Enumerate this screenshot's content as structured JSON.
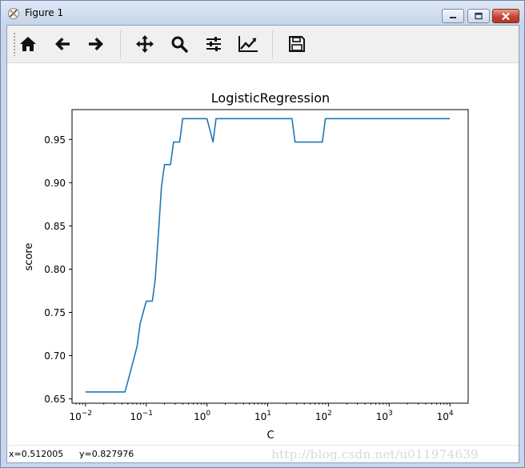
{
  "window": {
    "title": "Figure 1",
    "colors": {
      "accent": "#1f77b4",
      "close": "#c4402b"
    }
  },
  "toolbar": {
    "items": [
      {
        "name": "home-icon",
        "tooltip": "Home"
      },
      {
        "name": "back-arrow-icon",
        "tooltip": "Back"
      },
      {
        "name": "forward-arrow-icon",
        "tooltip": "Forward"
      },
      {
        "name": "pan-icon",
        "tooltip": "Pan"
      },
      {
        "name": "zoom-icon",
        "tooltip": "Zoom"
      },
      {
        "name": "subplots-icon",
        "tooltip": "Subplots"
      },
      {
        "name": "edit-axis-icon",
        "tooltip": "Customize"
      },
      {
        "name": "save-icon",
        "tooltip": "Save"
      }
    ]
  },
  "status": {
    "x_readout": "x=0.512005",
    "y_readout": "y=0.827976",
    "watermark": "http://blog.csdn.net/u011974639"
  },
  "chart_data": {
    "type": "line",
    "title": "LogisticRegression",
    "xlabel": "C",
    "ylabel": "score",
    "xscale": "log",
    "xlim": [
      0.006,
      20000
    ],
    "ylim": [
      0.645,
      0.9845
    ],
    "xticks": [
      {
        "value": 0.01,
        "base": "10",
        "exp": "−2"
      },
      {
        "value": 0.1,
        "base": "10",
        "exp": "−1"
      },
      {
        "value": 1,
        "base": "10",
        "exp": "0"
      },
      {
        "value": 10,
        "base": "10",
        "exp": "1"
      },
      {
        "value": 100,
        "base": "10",
        "exp": "2"
      },
      {
        "value": 1000,
        "base": "10",
        "exp": "3"
      },
      {
        "value": 10000,
        "base": "10",
        "exp": "4"
      }
    ],
    "yticks": [
      "0.65",
      "0.70",
      "0.75",
      "0.80",
      "0.85",
      "0.90",
      "0.95"
    ],
    "grid": false,
    "series": [
      {
        "color": "#1f77b4",
        "x": [
          0.01,
          0.0447,
          0.0562,
          0.0708,
          0.0794,
          0.1,
          0.126,
          0.141,
          0.159,
          0.178,
          0.2,
          0.251,
          0.282,
          0.355,
          0.398,
          1.0,
          1.26,
          1.41,
          10,
          25.1,
          28.2,
          79.4,
          89.1,
          100,
          1000,
          10000
        ],
        "y": [
          0.658,
          0.658,
          0.684,
          0.711,
          0.737,
          0.763,
          0.763,
          0.789,
          0.842,
          0.895,
          0.921,
          0.921,
          0.947,
          0.947,
          0.974,
          0.974,
          0.947,
          0.974,
          0.974,
          0.974,
          0.947,
          0.947,
          0.974,
          0.974,
          0.974,
          0.974
        ]
      }
    ]
  }
}
